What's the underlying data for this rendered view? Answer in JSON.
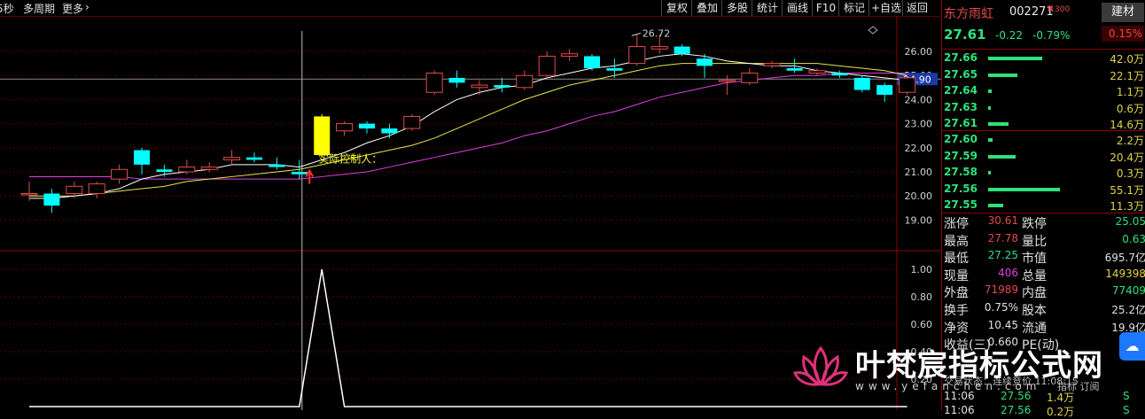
{
  "toolbar": {
    "left_items": [
      "5秒",
      "多周期",
      "更多",
      "›"
    ],
    "buttons": [
      "复权",
      "叠加",
      "多股",
      "统计",
      "画线",
      "F10",
      "标记",
      "+自选",
      "返回"
    ]
  },
  "chart": {
    "price_axis": [
      "26.00",
      "25.00",
      "24.00",
      "23.00",
      "22.00",
      "21.00",
      "20.00",
      "19.00"
    ],
    "current_price_label": "24.90",
    "high_marker": "26.72",
    "annotation": "实际控制人：",
    "indicator_axis": [
      "1.00",
      "0.80",
      "0.60",
      "0.40",
      "0.20"
    ],
    "colors": {
      "up": "#e34b4b",
      "down": "#00ffff",
      "ma_short": "#ffffff",
      "ma_mid": "#e8e84a",
      "ma_long": "#e040e0",
      "highlight": "#ffff00"
    }
  },
  "chart_data": {
    "type": "candlestick",
    "candles": [
      {
        "o": 20.1,
        "c": 20.1,
        "h": 20.6,
        "l": 19.8
      },
      {
        "o": 20.1,
        "c": 19.6,
        "h": 20.3,
        "l": 19.3
      },
      {
        "o": 20.1,
        "c": 20.4,
        "h": 20.6,
        "l": 19.9
      },
      {
        "o": 20.1,
        "c": 20.5,
        "h": 20.6,
        "l": 19.9
      },
      {
        "o": 20.7,
        "c": 21.1,
        "h": 21.3,
        "l": 20.5
      },
      {
        "o": 21.9,
        "c": 21.3,
        "h": 22.0,
        "l": 20.9
      },
      {
        "o": 21.1,
        "c": 21.0,
        "h": 21.3,
        "l": 20.8
      },
      {
        "o": 21.0,
        "c": 21.2,
        "h": 21.5,
        "l": 20.9
      },
      {
        "o": 21.1,
        "c": 21.2,
        "h": 21.4,
        "l": 21.0
      },
      {
        "o": 21.5,
        "c": 21.6,
        "h": 21.9,
        "l": 21.3
      },
      {
        "o": 21.6,
        "c": 21.5,
        "h": 21.8,
        "l": 21.4
      },
      {
        "o": 21.3,
        "c": 21.2,
        "h": 21.6,
        "l": 21.1
      },
      {
        "o": 21.0,
        "c": 20.9,
        "h": 21.5,
        "l": 20.7
      },
      {
        "o": 21.7,
        "c": 23.3,
        "h": 23.4,
        "l": 21.6
      },
      {
        "o": 22.7,
        "c": 23.0,
        "h": 23.1,
        "l": 22.5
      },
      {
        "o": 23.0,
        "c": 22.8,
        "h": 23.1,
        "l": 22.6
      },
      {
        "o": 22.8,
        "c": 22.6,
        "h": 23.0,
        "l": 22.4
      },
      {
        "o": 22.8,
        "c": 23.3,
        "h": 23.4,
        "l": 22.7
      },
      {
        "o": 24.3,
        "c": 25.1,
        "h": 25.2,
        "l": 24.2
      },
      {
        "o": 24.9,
        "c": 24.7,
        "h": 25.2,
        "l": 24.5
      },
      {
        "o": 24.5,
        "c": 24.6,
        "h": 24.8,
        "l": 24.2
      },
      {
        "o": 24.6,
        "c": 24.5,
        "h": 24.9,
        "l": 24.3
      },
      {
        "o": 24.5,
        "c": 25.0,
        "h": 25.2,
        "l": 24.4
      },
      {
        "o": 25.0,
        "c": 25.8,
        "h": 26.0,
        "l": 24.9
      },
      {
        "o": 25.8,
        "c": 25.9,
        "h": 26.1,
        "l": 25.6
      },
      {
        "o": 25.8,
        "c": 25.3,
        "h": 25.9,
        "l": 25.2
      },
      {
        "o": 25.3,
        "c": 25.2,
        "h": 25.7,
        "l": 24.9
      },
      {
        "o": 25.5,
        "c": 26.2,
        "h": 26.7,
        "l": 25.4
      },
      {
        "o": 26.1,
        "c": 26.2,
        "h": 26.7,
        "l": 25.9
      },
      {
        "o": 26.2,
        "c": 25.9,
        "h": 26.3,
        "l": 25.8
      },
      {
        "o": 25.7,
        "c": 25.4,
        "h": 25.9,
        "l": 24.9
      },
      {
        "o": 24.8,
        "c": 24.8,
        "h": 25.0,
        "l": 24.2
      },
      {
        "o": 24.7,
        "c": 25.1,
        "h": 25.3,
        "l": 24.6
      },
      {
        "o": 25.4,
        "c": 25.5,
        "h": 25.6,
        "l": 25.3
      },
      {
        "o": 25.3,
        "c": 25.2,
        "h": 25.7,
        "l": 25.1
      },
      {
        "o": 25.1,
        "c": 25.2,
        "h": 25.3,
        "l": 25.0
      },
      {
        "o": 25.1,
        "c": 25.0,
        "h": 25.2,
        "l": 24.9
      },
      {
        "o": 24.9,
        "c": 24.4,
        "h": 25.0,
        "l": 24.3
      },
      {
        "o": 24.6,
        "c": 24.2,
        "h": 24.7,
        "l": 23.9
      },
      {
        "o": 24.3,
        "c": 24.9,
        "h": 25.0,
        "l": 24.2
      }
    ],
    "ma_short": [
      19.9,
      19.9,
      20.0,
      20.1,
      20.3,
      20.7,
      20.9,
      21.0,
      21.1,
      21.3,
      21.3,
      21.3,
      21.2,
      21.5,
      21.8,
      22.2,
      22.5,
      22.9,
      23.5,
      24.0,
      24.3,
      24.5,
      24.6,
      24.9,
      25.1,
      25.3,
      25.4,
      25.6,
      25.8,
      25.9,
      25.8,
      25.6,
      25.5,
      25.4,
      25.4,
      25.2,
      25.1,
      25.0,
      24.9,
      24.8
    ],
    "ma_mid": [
      20.0,
      20.0,
      20.0,
      20.1,
      20.2,
      20.3,
      20.4,
      20.6,
      20.7,
      20.8,
      20.9,
      21.0,
      21.1,
      21.3,
      21.5,
      21.7,
      21.9,
      22.1,
      22.4,
      22.8,
      23.2,
      23.6,
      24.0,
      24.3,
      24.6,
      24.8,
      25.0,
      25.2,
      25.4,
      25.5,
      25.5,
      25.5,
      25.5,
      25.5,
      25.5,
      25.5,
      25.4,
      25.3,
      25.2,
      25.0
    ],
    "ma_long": [
      20.8,
      20.8,
      20.8,
      20.8,
      20.8,
      20.7,
      20.7,
      20.7,
      20.7,
      20.7,
      20.7,
      20.7,
      20.7,
      20.8,
      20.9,
      21.0,
      21.2,
      21.4,
      21.6,
      21.8,
      22.0,
      22.2,
      22.5,
      22.7,
      23.0,
      23.3,
      23.5,
      23.8,
      24.1,
      24.3,
      24.5,
      24.7,
      24.8,
      24.9,
      25.0,
      25.0,
      25.1,
      25.1,
      25.1,
      25.1
    ],
    "indicator": [
      0,
      0,
      0,
      0,
      0,
      0,
      0,
      0,
      0,
      0,
      0,
      0,
      0,
      1,
      0,
      0,
      0,
      0,
      0,
      0,
      0,
      0,
      0,
      0,
      0,
      0,
      0,
      0,
      0,
      0,
      0,
      0,
      0,
      0,
      0,
      0,
      0,
      0,
      0,
      0
    ],
    "ylim": [
      18.7,
      26.9
    ]
  },
  "quote": {
    "name": "东方雨虹",
    "code": "002271",
    "r_badge": "R",
    "r_num": "300",
    "sector": "建材",
    "sector_pct": "0.15%",
    "price": "27.61",
    "change": "-0.22",
    "change_pct": "-0.79%"
  },
  "orderbook": {
    "sells": [
      {
        "price": "27.66",
        "vol": "42.0万",
        "bar": 0.47
      },
      {
        "price": "27.65",
        "vol": "22.1万",
        "bar": 0.25
      },
      {
        "price": "27.64",
        "vol": "1.1万",
        "bar": 0.03
      },
      {
        "price": "27.63",
        "vol": "0.6万",
        "bar": 0.02
      },
      {
        "price": "27.61",
        "vol": "14.6万",
        "bar": 0.18
      }
    ],
    "buys": [
      {
        "price": "27.60",
        "vol": "2.2万",
        "bar": 0.04
      },
      {
        "price": "27.59",
        "vol": "20.4万",
        "bar": 0.24
      },
      {
        "price": "27.58",
        "vol": "0.3万",
        "bar": 0.02
      },
      {
        "price": "27.56",
        "vol": "55.1万",
        "bar": 0.62
      },
      {
        "price": "27.55",
        "vol": "11.3万",
        "bar": 0.13
      }
    ]
  },
  "stats": [
    {
      "l1": "涨停",
      "v1": "30.61",
      "c1": "#e34b4b",
      "l2": "跌停",
      "v2": "25.05",
      "c2": "#2ee27a"
    },
    {
      "l1": "最高",
      "v1": "27.78",
      "c1": "#e34b4b",
      "l2": "量比",
      "v2": "0.63",
      "c2": "#2ee27a"
    },
    {
      "l1": "最低",
      "v1": "27.25",
      "c1": "#2ee27a",
      "l2": "市值",
      "v2": "695.7亿",
      "c2": "#e0e0e0"
    },
    {
      "l1": "现量",
      "v1": "406",
      "c1": "#e040e0",
      "l2": "总量",
      "v2": "149398",
      "c2": "#e0d24b"
    },
    {
      "l1": "外盘",
      "v1": "71989",
      "c1": "#e34b4b",
      "l2": "内盘",
      "v2": "77409",
      "c2": "#2ee27a"
    },
    {
      "l1": "换手",
      "v1": "0.75%",
      "c1": "#e0e0e0",
      "l2": "股本",
      "v2": "25.2亿",
      "c2": "#e0e0e0"
    },
    {
      "l1": "净资",
      "v1": "10.45",
      "c1": "#e0e0e0",
      "l2": "流通",
      "v2": "19.9亿",
      "c2": "#e0e0e0"
    },
    {
      "l1": "收益(三)",
      "v1": "0.660",
      "c1": "#e0e0e0",
      "l2": "PE(动)",
      "v2": "",
      "c2": "#e0e0e0"
    }
  ],
  "status_line": "交易状态：连续竞价 11:08:15",
  "trades_header": "指标  订阅",
  "trades": [
    {
      "time": "11:06",
      "price": "27.56",
      "vol": "1.4万",
      "side": "S"
    },
    {
      "time": "11:06",
      "price": "27.56",
      "vol": "0.2万",
      "side": "S"
    }
  ],
  "watermark": {
    "text": "叶梵宸指标公式网",
    "url": "www.yefanchen.com"
  }
}
